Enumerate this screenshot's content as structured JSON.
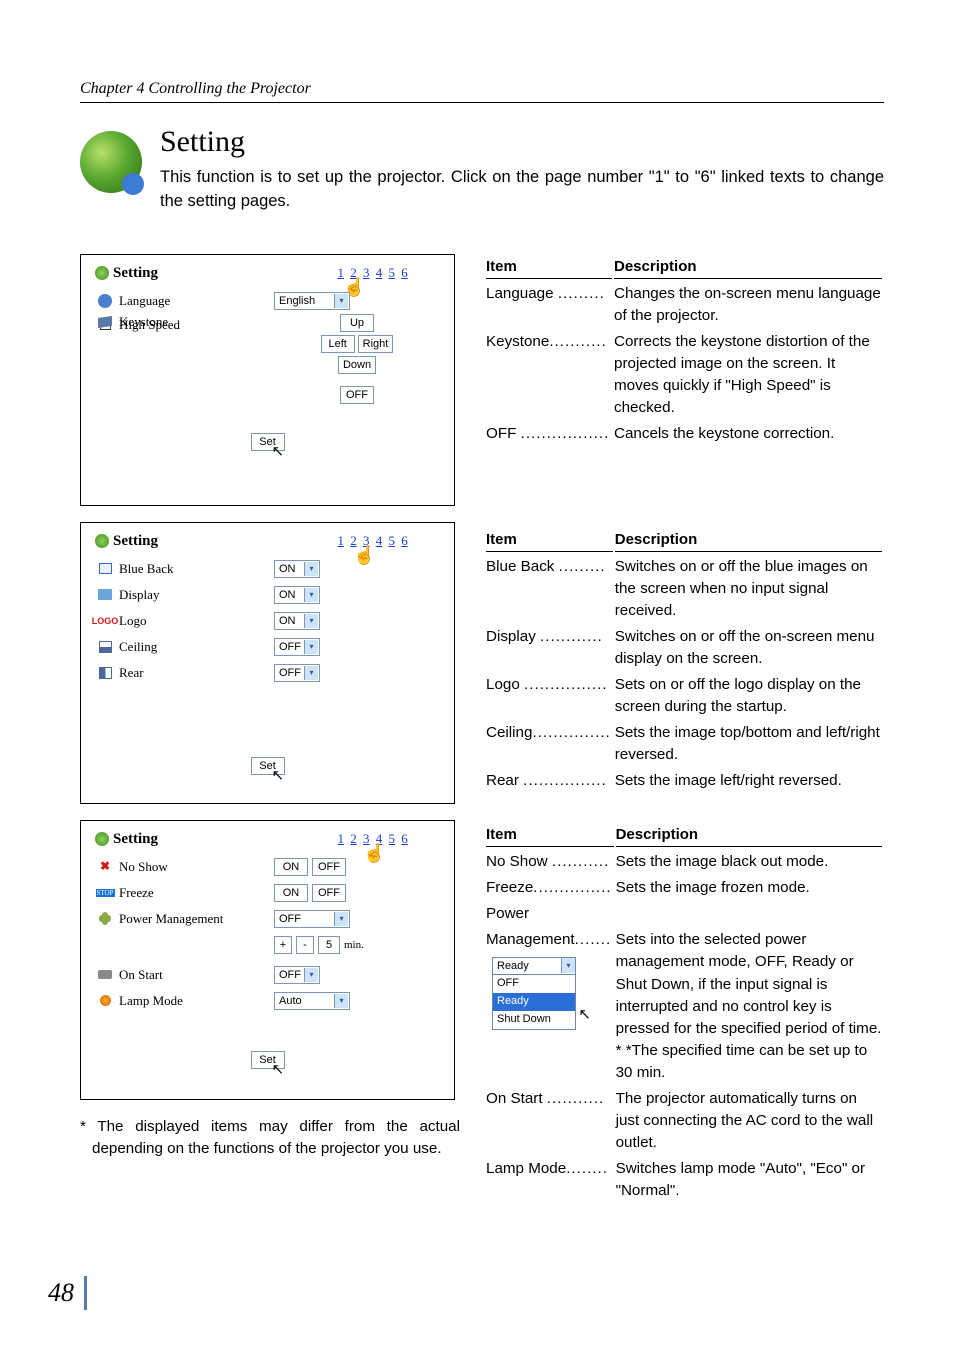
{
  "chapter_header": "Chapter 4 Controlling the Projector",
  "heading": {
    "title": "Setting",
    "desc": "This function is to set up the projector. Click on the page number \"1\" to \"6\" linked texts to change the setting pages."
  },
  "pager": {
    "p1": "1",
    "p2": "2",
    "p3": "3",
    "p4": "4",
    "p5": "5",
    "p6": "6"
  },
  "panel1": {
    "title": "Setting",
    "language_label": "Language",
    "language_value": "English",
    "keystone_label": "Keystone",
    "highspeed_label": "High Speed",
    "btn_up": "Up",
    "btn_left": "Left",
    "btn_right": "Right",
    "btn_down": "Down",
    "btn_off": "OFF",
    "set": "Set"
  },
  "panel2": {
    "title": "Setting",
    "blueback_label": "Blue Back",
    "blueback_value": "ON",
    "display_label": "Display",
    "display_value": "ON",
    "logo_label": "Logo",
    "logo_value": "ON",
    "ceiling_label": "Ceiling",
    "ceiling_value": "OFF",
    "rear_label": "Rear",
    "rear_value": "OFF",
    "set": "Set"
  },
  "panel3": {
    "title": "Setting",
    "noshow_label": "No Show",
    "freeze_label": "Freeze",
    "on": "ON",
    "off": "OFF",
    "pm_label": "Power Management",
    "pm_value": "OFF",
    "timer_value": "5",
    "timer_unit": "min.",
    "plus": "+",
    "minus": "-",
    "onstart_label": "On Start",
    "onstart_value": "OFF",
    "lamp_label": "Lamp Mode",
    "lamp_value": "Auto",
    "set": "Set"
  },
  "tables": {
    "h_item": "Item",
    "h_desc": "Description",
    "t1": {
      "language_k": "Language",
      "language_v": "Changes the on-screen menu language of the projector.",
      "keystone_k": "Keystone",
      "keystone_v": "Corrects the keystone distortion of the projected image on the screen. It moves quickly if \"High Speed\" is checked.",
      "off_k": "OFF",
      "off_v": "Cancels the keystone correction."
    },
    "t2": {
      "blueback_k": "Blue Back",
      "blueback_v": "Switches on or off the blue images on the screen when no input signal received.",
      "display_k": "Display",
      "display_v": "Switches on or off the on-screen menu display on the screen.",
      "logo_k": "Logo",
      "logo_v": "Sets on or off the logo display on the screen during the startup.",
      "ceiling_k": "Ceiling",
      "ceiling_v": "Sets the image top/bottom and left/right reversed.",
      "rear_k": "Rear",
      "rear_v": "Sets the image left/right reversed."
    },
    "t3": {
      "noshow_k": "No Show",
      "noshow_v": "Sets the image black out mode.",
      "freeze_k": "Freeze",
      "freeze_v": "Sets the image frozen mode.",
      "power_k": "Power",
      "pm_k": "Management",
      "pm_v": "Sets into the selected power management mode, OFF, Ready or Shut Down, if the input signal is interrupted and no control key is pressed for the specified period of time. * *The specified time can be set up to 30 min.",
      "onstart_k": "On Start",
      "onstart_v": "The projector automatically turns on just connecting the AC cord to the wall outlet.",
      "lamp_k": "Lamp Mode",
      "lamp_v": "Switches lamp mode \"Auto\", \"Eco\" or \"Normal\"."
    }
  },
  "dropdown_fig": {
    "top": "Ready",
    "o1": "OFF",
    "o2": "Ready",
    "o3": "Shut Down"
  },
  "footnote": "* The displayed items may differ from the actual depending on the functions of the projector you use.",
  "page_number": "48",
  "dots": {
    "d9": ".........",
    "d10": "..........",
    "d11": "...........",
    "d12": "............",
    "d14": "..............",
    "d15": "...............",
    "d16": "................",
    "d17": ".................",
    "d6": "......",
    "d7": ".......",
    "d8": "........"
  }
}
